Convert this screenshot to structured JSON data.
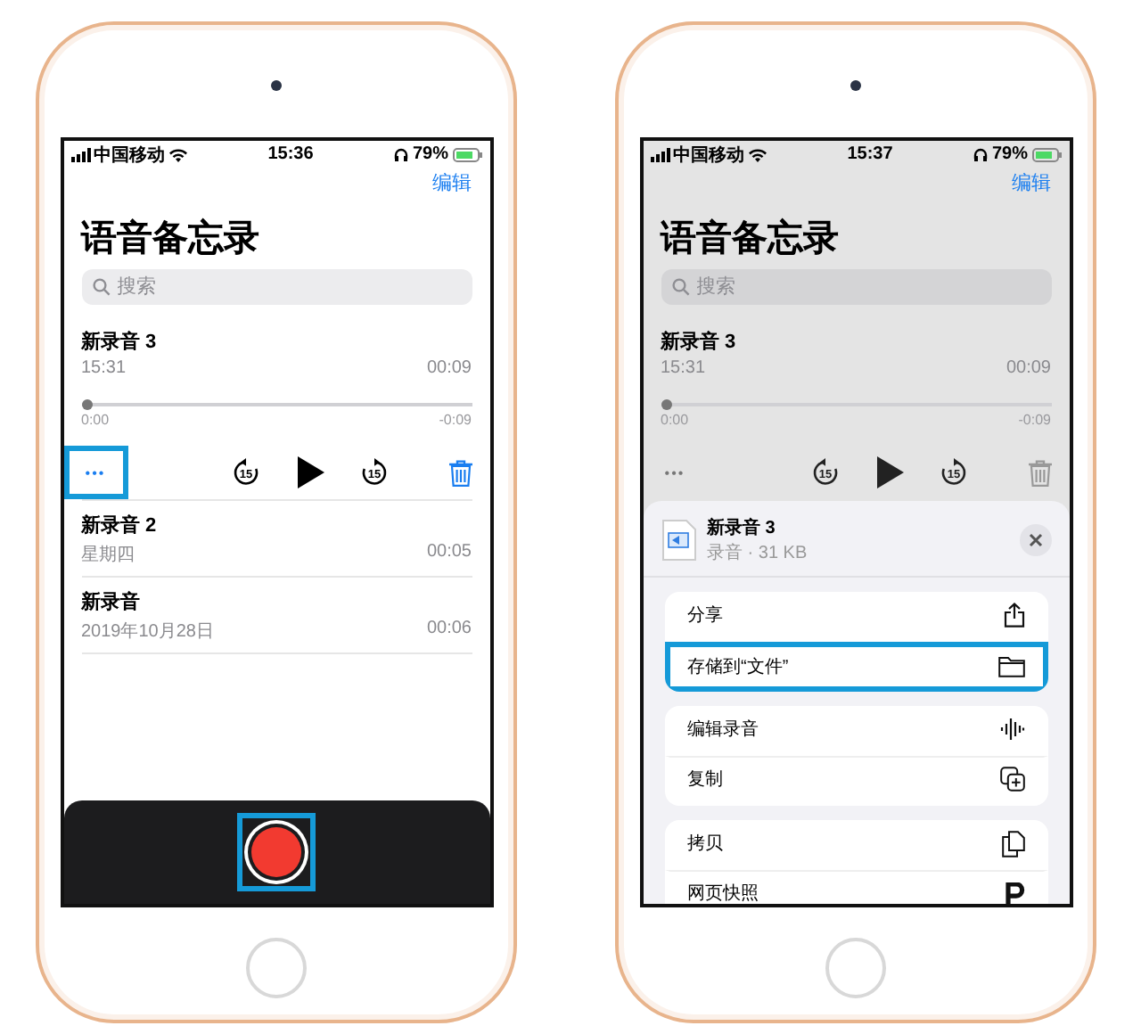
{
  "phones": [
    {
      "dimmed": false,
      "status_bar": {
        "carrier": "中国移动",
        "time": "15:36",
        "battery": "79%"
      },
      "edit": "编辑",
      "title": "语音备忘录",
      "search": {
        "placeholder": "搜索"
      },
      "expanded": {
        "name": "新录音 3",
        "time": "15:31",
        "duration": "00:09",
        "level": 0,
        "elapsed": "0:00",
        "remaining": "-0:09",
        "skip_back_seconds": "15",
        "skip_forward_seconds": "15",
        "more": "•••",
        "more_highlighted": true
      },
      "recordings": [
        {
          "name": "新录音 2",
          "date": "星期四",
          "duration": "00:05"
        },
        {
          "name": "新录音",
          "date": "2019年10月28日",
          "duration": "00:06"
        }
      ],
      "record_bar": {
        "highlighted": true
      }
    },
    {
      "dimmed": true,
      "status_bar": {
        "carrier": "中国移动",
        "time": "15:37",
        "battery": "79%"
      },
      "edit": "编辑",
      "title": "语音备忘录",
      "search": {
        "placeholder": "搜索"
      },
      "expanded": {
        "name": "新录音 3",
        "time": "15:31",
        "duration": "00:09",
        "level": 0,
        "elapsed": "0:00",
        "remaining": "-0:09",
        "skip_back_seconds": "15",
        "skip_forward_seconds": "15",
        "more": "•••",
        "more_highlighted": false
      },
      "sheet": {
        "file_name": "新录音 3",
        "file_info": "录音 · 31 KB",
        "groups": [
          [
            {
              "label": "分享",
              "kind": "share",
              "highlighted": false
            },
            {
              "label": "存储到“文件”",
              "kind": "folder",
              "highlighted": true
            }
          ],
          [
            {
              "label": "编辑录音",
              "kind": "waveform",
              "highlighted": false
            },
            {
              "label": "复制",
              "kind": "duplicate",
              "highlighted": false
            }
          ],
          [
            {
              "label": "拷贝",
              "kind": "copy",
              "highlighted": false
            },
            {
              "label": "网页快照",
              "kind": "snapshot",
              "highlighted": false
            }
          ]
        ]
      }
    }
  ]
}
